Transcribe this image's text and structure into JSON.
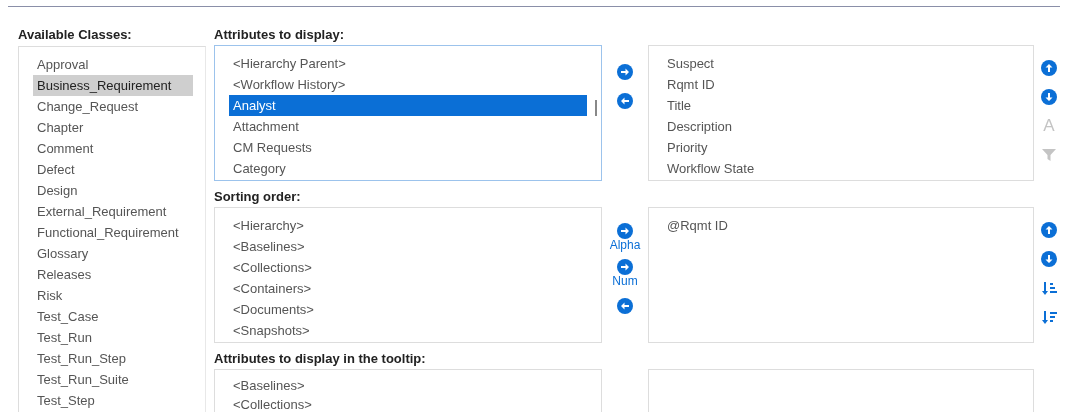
{
  "available_classes": {
    "label": "Available Classes:",
    "items": [
      {
        "label": "Approval",
        "selected": false
      },
      {
        "label": "Business_Requirement",
        "selected": true
      },
      {
        "label": "Change_Request",
        "selected": false
      },
      {
        "label": "Chapter",
        "selected": false
      },
      {
        "label": "Comment",
        "selected": false
      },
      {
        "label": "Defect",
        "selected": false
      },
      {
        "label": "Design",
        "selected": false
      },
      {
        "label": "External_Requirement",
        "selected": false
      },
      {
        "label": "Functional_Requirement",
        "selected": false
      },
      {
        "label": "Glossary",
        "selected": false
      },
      {
        "label": "Releases",
        "selected": false
      },
      {
        "label": "Risk",
        "selected": false
      },
      {
        "label": "Test_Case",
        "selected": false
      },
      {
        "label": "Test_Run",
        "selected": false
      },
      {
        "label": "Test_Run_Step",
        "selected": false
      },
      {
        "label": "Test_Run_Suite",
        "selected": false
      },
      {
        "label": "Test_Step",
        "selected": false
      }
    ]
  },
  "sections": [
    {
      "label": "Attributes to display:",
      "focused": true,
      "available": [
        {
          "label": "<Hierarchy Parent>",
          "selected": false
        },
        {
          "label": "<Workflow History>",
          "selected": false
        },
        {
          "label": "Analyst",
          "selected": true
        },
        {
          "label": "Attachment",
          "selected": false
        },
        {
          "label": "CM Requests",
          "selected": false
        },
        {
          "label": "Category",
          "selected": false
        }
      ],
      "transfer_buttons": [
        {
          "kind": "add"
        },
        {
          "kind": "remove"
        }
      ],
      "chosen": [
        {
          "label": "Suspect"
        },
        {
          "label": "Rqmt ID"
        },
        {
          "label": "Title"
        },
        {
          "label": "Description"
        },
        {
          "label": "Priority"
        },
        {
          "label": "Workflow State"
        }
      ],
      "actions": [
        {
          "kind": "move_up",
          "disabled": false
        },
        {
          "kind": "move_down",
          "disabled": false
        },
        {
          "kind": "letter",
          "label": "A",
          "disabled": true
        },
        {
          "kind": "filter",
          "disabled": true
        }
      ]
    },
    {
      "label": "Sorting order:",
      "focused": false,
      "available": [
        {
          "label": "<Hierarchy>",
          "selected": false
        },
        {
          "label": "<Baselines>",
          "selected": false
        },
        {
          "label": "<Collections>",
          "selected": false
        },
        {
          "label": "<Containers>",
          "selected": false
        },
        {
          "label": "<Documents>",
          "selected": false
        },
        {
          "label": "<Snapshots>",
          "selected": false
        }
      ],
      "transfer_buttons": [
        {
          "kind": "add",
          "label": "Alpha"
        },
        {
          "kind": "add",
          "label": "Num"
        },
        {
          "kind": "remove"
        }
      ],
      "chosen": [
        {
          "label": "@Rqmt ID"
        }
      ],
      "actions": [
        {
          "kind": "move_up",
          "disabled": false
        },
        {
          "kind": "move_down",
          "disabled": false
        },
        {
          "kind": "sort_ascending",
          "disabled": false
        },
        {
          "kind": "sort_descending",
          "disabled": false
        }
      ]
    },
    {
      "label": "Attributes to display in the tooltip:",
      "focused": false,
      "available": [
        {
          "label": "<Baselines>",
          "selected": false
        },
        {
          "label": "<Collections>",
          "selected": false
        }
      ]
    }
  ]
}
